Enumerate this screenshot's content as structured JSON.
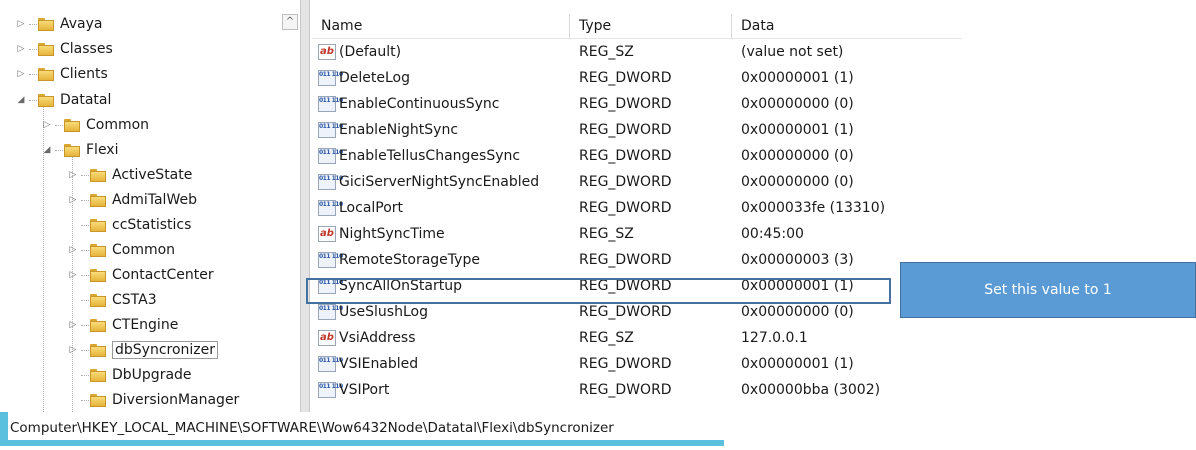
{
  "tree": {
    "items": [
      {
        "label": "Avaya",
        "toggle": "▷"
      },
      {
        "label": "Classes",
        "toggle": "▷"
      },
      {
        "label": "Clients",
        "toggle": "▷"
      },
      {
        "label": "Datatal",
        "toggle": "◢"
      },
      {
        "label": "Common",
        "toggle": "▷"
      },
      {
        "label": "Flexi",
        "toggle": "◢"
      },
      {
        "label": "ActiveState",
        "toggle": "▷"
      },
      {
        "label": "AdmiTalWeb",
        "toggle": "▷"
      },
      {
        "label": "ccStatistics",
        "toggle": ""
      },
      {
        "label": "Common",
        "toggle": "▷"
      },
      {
        "label": "ContactCenter",
        "toggle": "▷"
      },
      {
        "label": "CSTA3",
        "toggle": ""
      },
      {
        "label": "CTEngine",
        "toggle": "▷"
      },
      {
        "label": "dbSyncronizer",
        "toggle": "▷"
      },
      {
        "label": "DbUpgrade",
        "toggle": ""
      },
      {
        "label": "DiversionManager",
        "toggle": ""
      }
    ],
    "scroll_up": "^"
  },
  "columns": {
    "name": "Name",
    "type": "Type",
    "data": "Data"
  },
  "values": [
    {
      "icon": "ab",
      "name": "(Default)",
      "type": "REG_SZ",
      "data": "(value not set)"
    },
    {
      "icon": "bin",
      "name": "DeleteLog",
      "type": "REG_DWORD",
      "data": "0x00000001 (1)"
    },
    {
      "icon": "bin",
      "name": "EnableContinuousSync",
      "type": "REG_DWORD",
      "data": "0x00000000 (0)"
    },
    {
      "icon": "bin",
      "name": "EnableNightSync",
      "type": "REG_DWORD",
      "data": "0x00000001 (1)"
    },
    {
      "icon": "bin",
      "name": "EnableTellusChangesSync",
      "type": "REG_DWORD",
      "data": "0x00000000 (0)"
    },
    {
      "icon": "bin",
      "name": "GiciServerNightSyncEnabled",
      "type": "REG_DWORD",
      "data": "0x00000000 (0)"
    },
    {
      "icon": "bin",
      "name": "LocalPort",
      "type": "REG_DWORD",
      "data": "0x000033fe (13310)"
    },
    {
      "icon": "ab",
      "name": "NightSyncTime",
      "type": "REG_SZ",
      "data": "00:45:00"
    },
    {
      "icon": "bin",
      "name": "RemoteStorageType",
      "type": "REG_DWORD",
      "data": "0x00000003 (3)"
    },
    {
      "icon": "bin",
      "name": "SyncAllOnStartup",
      "type": "REG_DWORD",
      "data": "0x00000001 (1)"
    },
    {
      "icon": "bin",
      "name": "UseSlushLog",
      "type": "REG_DWORD",
      "data": "0x00000000 (0)"
    },
    {
      "icon": "ab",
      "name": "VsiAddress",
      "type": "REG_SZ",
      "data": "127.0.0.1"
    },
    {
      "icon": "bin",
      "name": "VSIEnabled",
      "type": "REG_DWORD",
      "data": "0x00000001 (1)"
    },
    {
      "icon": "bin",
      "name": "VSIPort",
      "type": "REG_DWORD",
      "data": "0x00000bba (3002)"
    }
  ],
  "icons": {
    "ab": "ab",
    "bin": "011 110"
  },
  "callout": {
    "text": "Set this value to 1"
  },
  "status": {
    "path": "Computer\\HKEY_LOCAL_MACHINE\\SOFTWARE\\Wow6432Node\\Datatal\\Flexi\\dbSyncronizer"
  },
  "colors": {
    "callout": "#5b9bd5",
    "highlight_border": "#4472a0",
    "status_accent": "#5bc0de"
  }
}
